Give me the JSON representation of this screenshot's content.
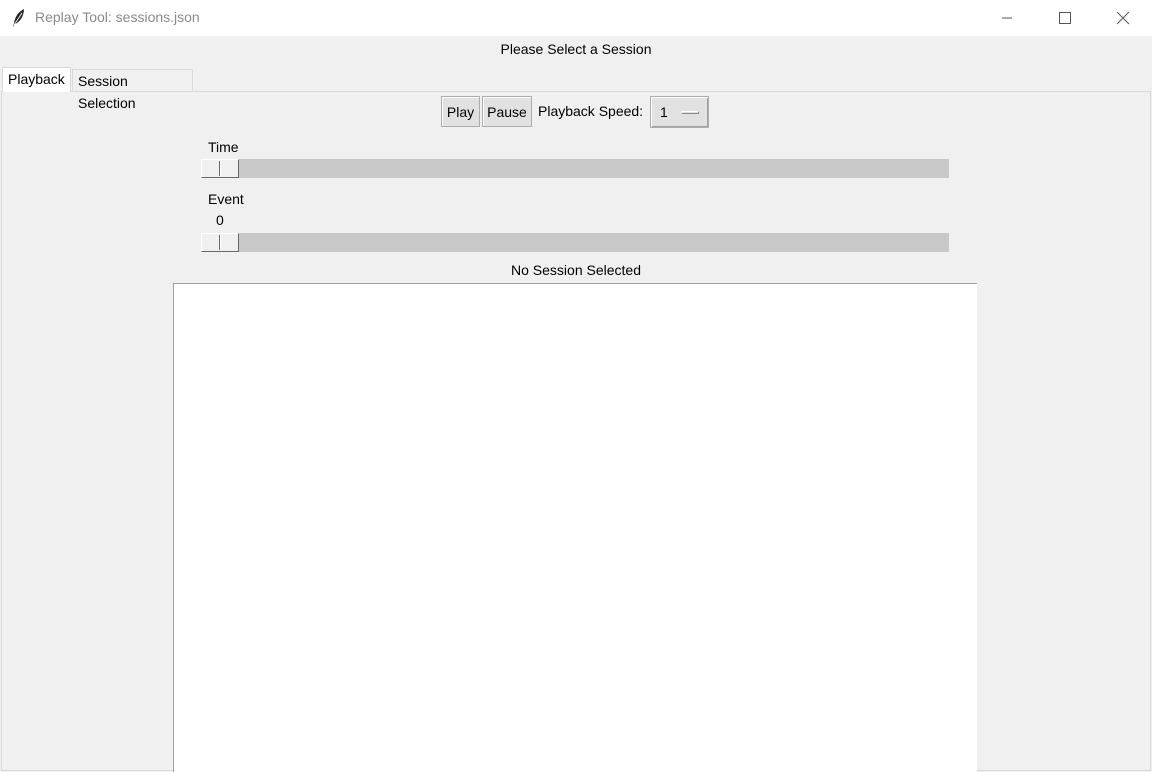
{
  "window": {
    "title": "Replay Tool: sessions.json",
    "controls": {
      "minimize_icon": "minimize-icon",
      "maximize_icon": "maximize-icon",
      "close_icon": "close-icon"
    }
  },
  "header": {
    "session_prompt": "Please Select a Session"
  },
  "tabs": [
    {
      "label": "Playback",
      "active": true
    },
    {
      "label": "Session Selection",
      "active": false
    }
  ],
  "toolbar": {
    "play_label": "Play",
    "pause_label": "Pause",
    "speed_label": "Playback Speed:",
    "speed_value": "1"
  },
  "sliders": {
    "time": {
      "label": "Time",
      "value_fraction": 0
    },
    "event": {
      "label": "Event",
      "value": "0",
      "value_fraction": 0
    }
  },
  "status": {
    "text": "No Session Selected"
  },
  "colors": {
    "window_bg": "#f0f0f0",
    "canvas_bg": "#ffffff",
    "trough": "#c8c8c8"
  }
}
